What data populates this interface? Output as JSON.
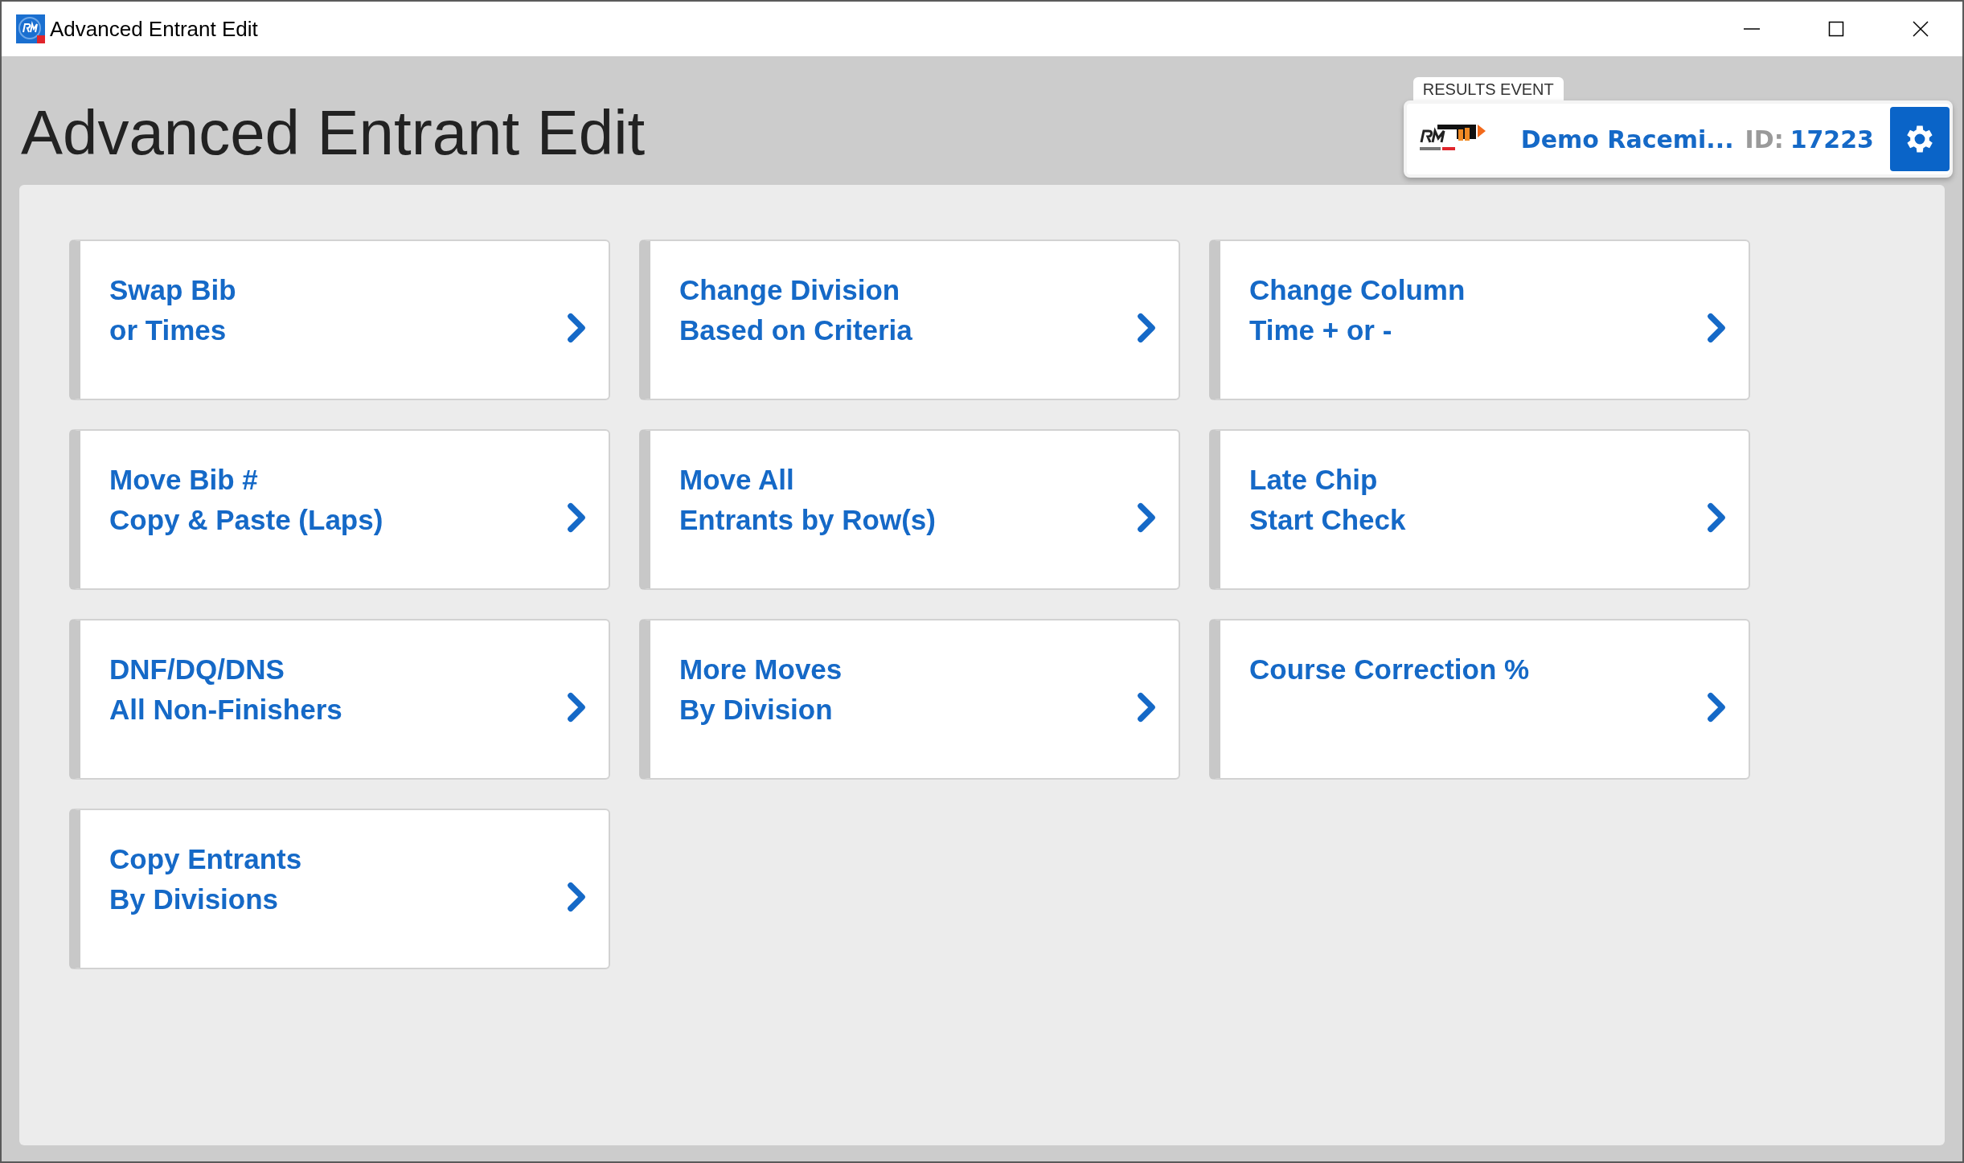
{
  "window": {
    "title": "Advanced Entrant Edit"
  },
  "page_title": "Advanced Entrant Edit",
  "results_event": {
    "label": "RESULTS EVENT",
    "event_name": "Demo Racemi...",
    "id_label": "ID:",
    "id_value": "17223"
  },
  "tiles": [
    {
      "lines": [
        "Swap Bib",
        "or Times"
      ]
    },
    {
      "lines": [
        "Change Division",
        "Based on Criteria"
      ]
    },
    {
      "lines": [
        "Change Column",
        "Time + or -"
      ]
    },
    {
      "lines": [
        "Move Bib #",
        "Copy & Paste (Laps)"
      ]
    },
    {
      "lines": [
        "Move All",
        "Entrants by Row(s)"
      ]
    },
    {
      "lines": [
        "Late Chip",
        "Start Check"
      ]
    },
    {
      "lines": [
        "DNF/DQ/DNS",
        "All Non-Finishers"
      ]
    },
    {
      "lines": [
        "More Moves",
        "By Division"
      ]
    },
    {
      "lines": [
        "Course Correction %"
      ]
    },
    {
      "lines": [
        "Copy Entrants",
        "By Divisions"
      ]
    }
  ]
}
